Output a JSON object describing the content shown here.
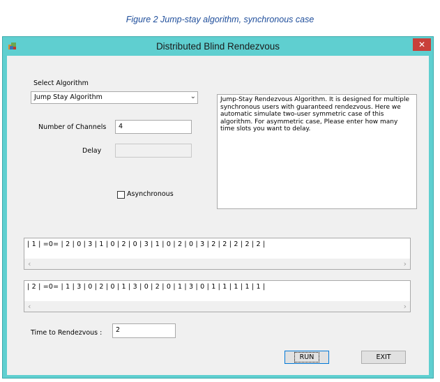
{
  "caption": "Figure 2 Jump-stay algorithm, synchronous case",
  "window": {
    "title": "Distributed Blind Rendezvous",
    "close_label": "✕"
  },
  "form": {
    "select_algorithm_label": "Select Algorithm",
    "algorithm_selected": "Jump Stay Algorithm",
    "channels_label": "Number of Channels",
    "channels_value": "4",
    "delay_label": "Delay",
    "delay_value": "",
    "async_label": "Asynchronous",
    "async_checked": false,
    "description": "Jump-Stay Rendezvous Algorithm. It is designed for multiple synchronous users with guaranteed rendezvous. Here we automatic simulate two-user symmetric case of this algorithm. For asymmetric case, Please enter how many time slots you want to delay."
  },
  "sequences": {
    "user1": "| 1 | =0= | 2 | 0 | 3 | 1 | 0 | 2 | 0 | 3 | 1 | 0 | 2 | 0 | 3 | 2 | 2 | 2 | 2 | 2 |",
    "user2": "| 2 | =0= | 1 | 3 | 0 | 2 | 0 | 1 | 3 | 0 | 2 | 0 | 1 | 3 | 0 | 1 | 1 | 1 | 1 | 1 |",
    "scroll_left": "‹",
    "scroll_right": "›"
  },
  "result": {
    "label": "Time to Rendezvous :",
    "value": "2"
  },
  "buttons": {
    "run": "RUN",
    "exit": "EXIT"
  },
  "colors": {
    "titlebar": "#5fcfd0",
    "close": "#c9403a",
    "caption": "#1f4e9b",
    "client": "#f0f0f0"
  }
}
